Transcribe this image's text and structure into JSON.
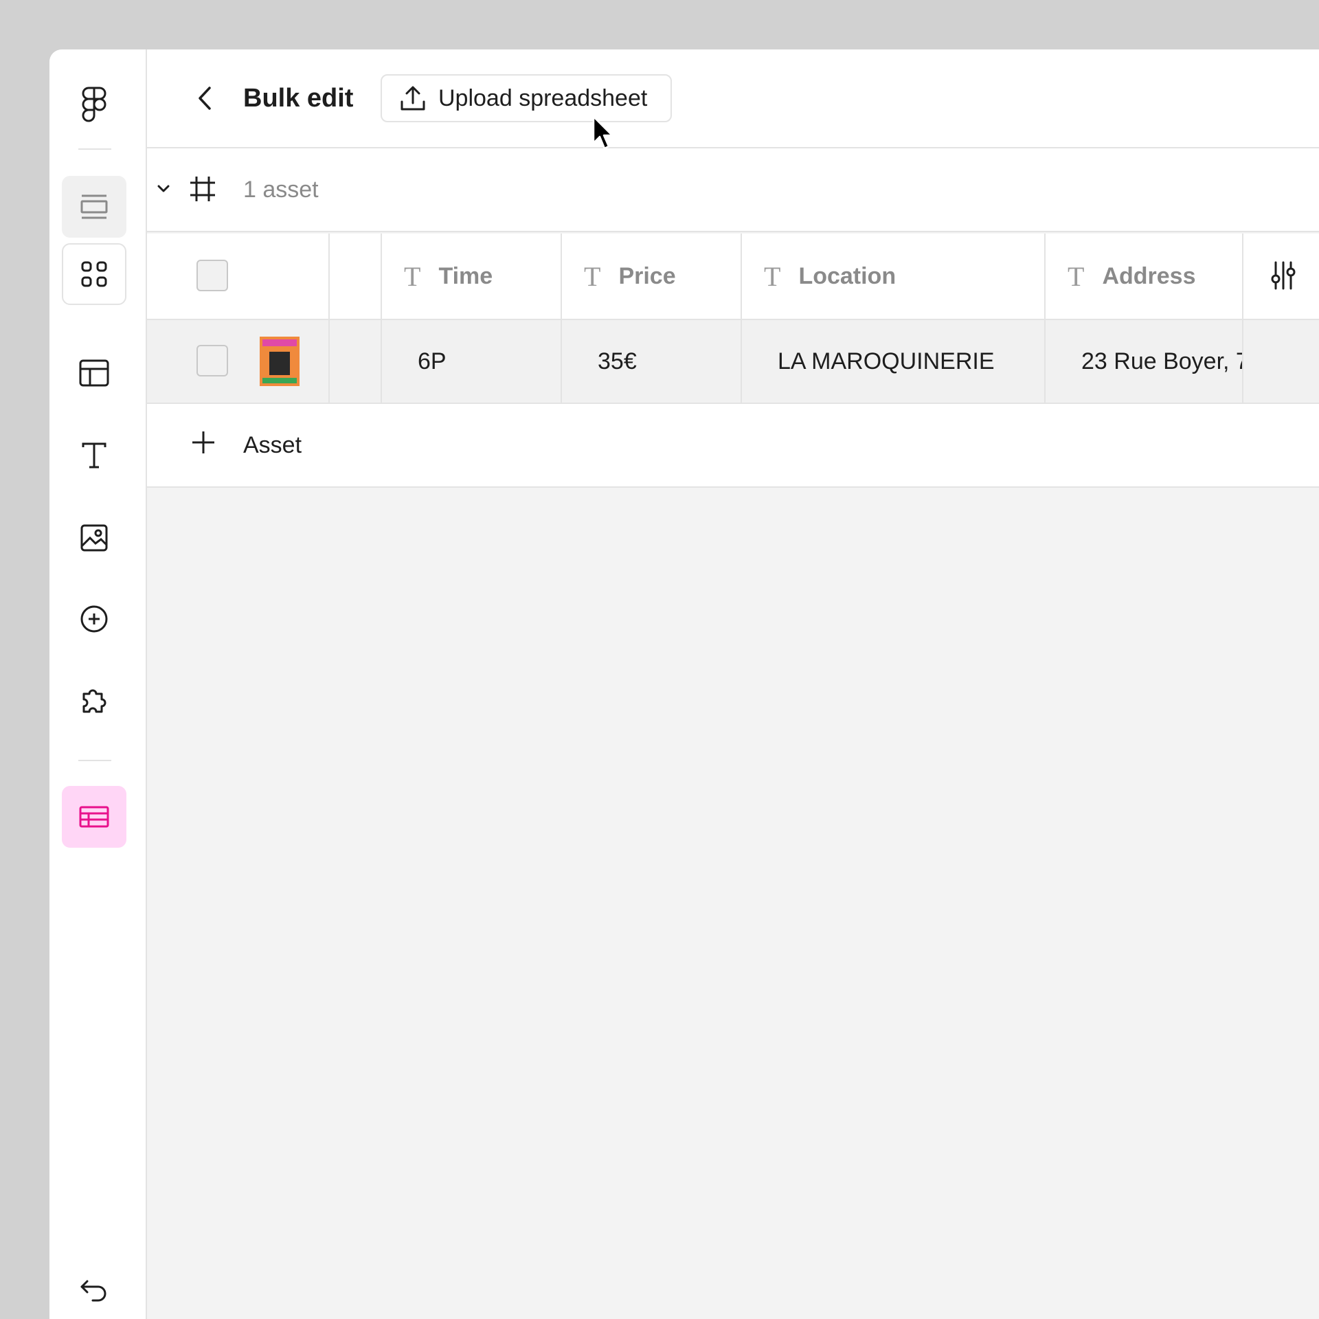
{
  "header": {
    "title": "Bulk edit",
    "upload_label": "Upload spreadsheet"
  },
  "group": {
    "count_label": "1 asset"
  },
  "table": {
    "columns": [
      {
        "type_icon": "T",
        "label": "Time"
      },
      {
        "type_icon": "T",
        "label": "Price"
      },
      {
        "type_icon": "T",
        "label": "Location"
      },
      {
        "type_icon": "T",
        "label": "Address"
      }
    ],
    "rows": [
      {
        "time": "6P",
        "price": "35€",
        "location": "LA MAROQUINERIE",
        "address": "23 Rue Boyer, 7"
      }
    ]
  },
  "add_row": {
    "label": "Asset"
  },
  "colors": {
    "accent_pink": "#e8118c",
    "active_pink_bg": "#ffd6f6",
    "border": "#e3e3e3"
  }
}
